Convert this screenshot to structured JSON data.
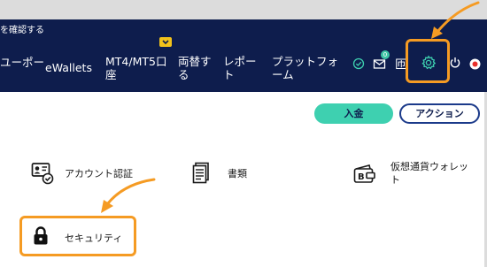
{
  "notice": {
    "text": "を確認する"
  },
  "nav": {
    "items": [
      {
        "label": "ユーポー"
      },
      {
        "label": "eWallets"
      },
      {
        "label": "MT4/MT5口\n座"
      },
      {
        "label": "両替す\nる"
      },
      {
        "label": "レポー\nト"
      },
      {
        "label": "プラットフォ\nーム"
      }
    ],
    "badge_count": "0",
    "partial_char": "匝"
  },
  "buttons": {
    "deposit": "入金",
    "action": "アクション"
  },
  "menu": {
    "account_verification": "アカウント認証",
    "documents": "書類",
    "crypto_wallet": "仮想通貨ウォレッ\nト",
    "security": "セキュリティ"
  },
  "colors": {
    "navy": "#0e1d4d",
    "teal": "#3ed0b0",
    "orange": "#f59b23",
    "yellow": "#f2c21b"
  },
  "icons": [
    "check-circle-icon",
    "mail-icon",
    "gear-icon",
    "power-icon",
    "flag-japan-icon",
    "id-card-icon",
    "document-icon",
    "wallet-icon",
    "lock-icon",
    "chevron-down-icon",
    "arrow-annotation-icon"
  ]
}
